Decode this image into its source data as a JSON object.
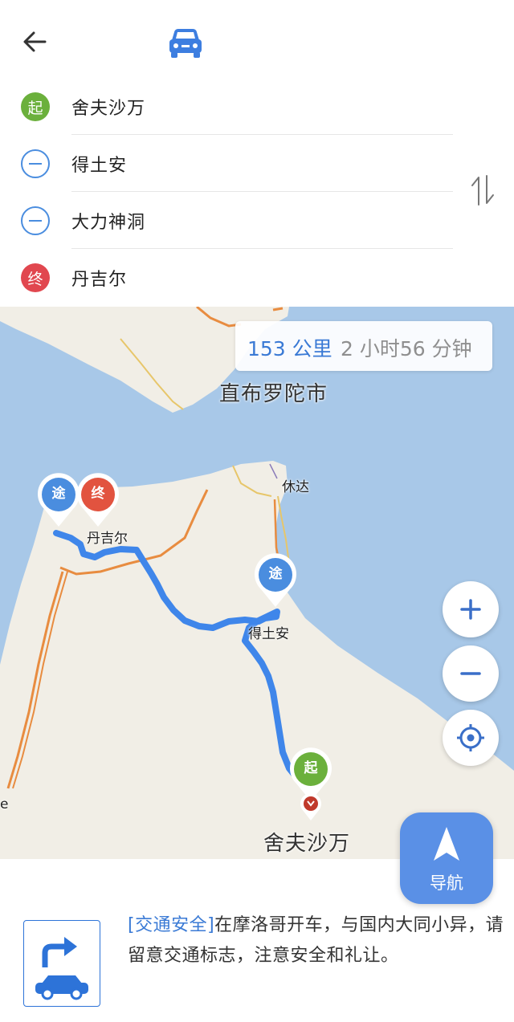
{
  "header": {
    "back_icon": "back-arrow-icon",
    "mode_icon": "car-icon"
  },
  "route": {
    "stops": [
      {
        "type": "start",
        "badge": "起",
        "name": "舍夫沙万"
      },
      {
        "type": "via",
        "badge": "",
        "name": "得土安"
      },
      {
        "type": "via",
        "badge": "",
        "name": "大力神洞"
      },
      {
        "type": "end",
        "badge": "终",
        "name": "丹吉尔"
      }
    ],
    "swap_icon": "swap-arrows-icon"
  },
  "map": {
    "summary": {
      "distance": "153 公里",
      "duration": "2 小时56 分钟"
    },
    "labels": {
      "gibraltar": "直布罗陀市",
      "ceuta": "休达",
      "tangier": "丹吉尔",
      "tetouan": "得土安",
      "chefchaouen": "舍夫沙万",
      "edge": "e"
    },
    "pins": {
      "via": "途",
      "end": "终",
      "start": "起"
    },
    "controls": {
      "zoom_in": "+",
      "zoom_out": "−",
      "locate_icon": "locate-icon"
    },
    "colors": {
      "water": "#a8c8e8",
      "land": "#f1eee6",
      "route": "#3f86ea",
      "road": "#e88c40"
    }
  },
  "navigate": {
    "label": "导航",
    "icon": "navigation-arrow-icon"
  },
  "tip": {
    "tag": "[交通安全]",
    "text": "在摩洛哥开车，与国内大同小异，请留意交通标志，注意安全和礼让。",
    "icon": "turn-car-icon"
  }
}
